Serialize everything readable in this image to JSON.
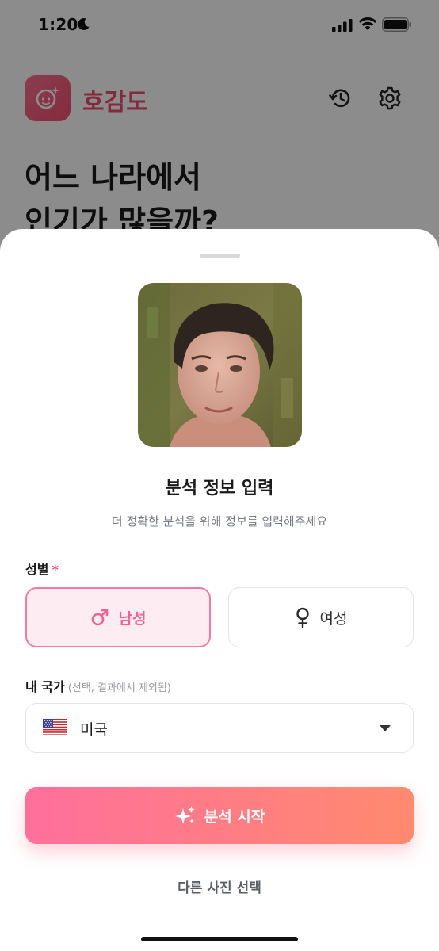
{
  "status_bar": {
    "time": "1:20",
    "icons": [
      "moon-icon",
      "signal-icon",
      "wifi-icon",
      "battery-icon"
    ]
  },
  "app": {
    "title": "호감도",
    "logo_icon": "face-sparkle-icon",
    "header_icons": [
      "history-icon",
      "gear-icon"
    ],
    "headline_line1": "어느 나라에서",
    "headline_line2": "인기가 많을까?"
  },
  "sheet": {
    "title": "분석 정보 입력",
    "subtitle": "더 정확한 분석을 위해 정보를 입력해주세요",
    "gender": {
      "label": "성별",
      "required_mark": "*",
      "options": [
        {
          "label": "남성",
          "icon": "male-symbol-icon",
          "selected": true
        },
        {
          "label": "여성",
          "icon": "female-symbol-icon",
          "selected": false
        }
      ]
    },
    "country": {
      "label": "내 국가",
      "hint": "(선택, 결과에서 제외됨)",
      "value": "미국",
      "flag_icon": "us-flag-icon"
    },
    "start_button": {
      "label": "분석 시작",
      "icon": "sparkle-icon"
    },
    "other_photo_label": "다른 사진 선택"
  },
  "colors": {
    "accent_pink": "#f06292",
    "brand_red": "#ef4d6f",
    "gradient_start": "#ff6f9c",
    "gradient_end": "#ff8a6e",
    "selected_bg": "#fdedf3"
  }
}
